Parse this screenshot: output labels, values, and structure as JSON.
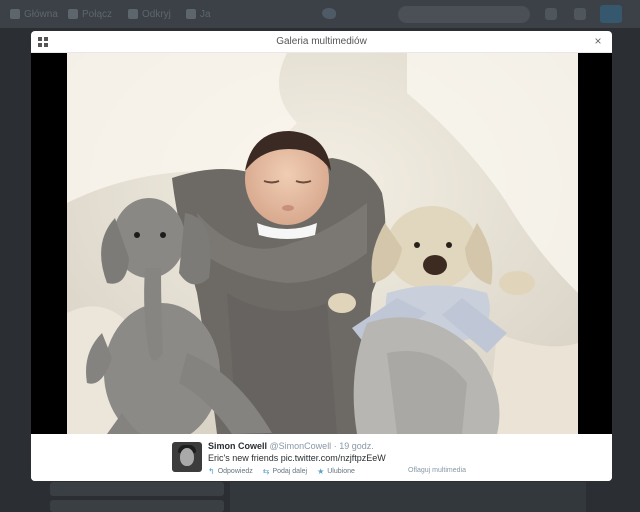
{
  "topbar": {
    "home_label": "Główna",
    "connect_label": "Połącz",
    "discover_label": "Odkryj",
    "me_label": "Ja"
  },
  "modal": {
    "title": "Galeria multimediów",
    "close_glyph": "×"
  },
  "tweet": {
    "name": "Simon Cowell",
    "handle": "@SimonCowell",
    "separator": "·",
    "time": "19 godz.",
    "text": "Eric's new friends pic.twitter.com/nzjftpzEeW",
    "actions": {
      "reply_label": "Odpowiedz",
      "retweet_label": "Podaj dalej",
      "favorite_label": "Ulubione"
    },
    "flag_label": "Oflaguj multimedia"
  },
  "icons": {
    "reply": "reply-icon",
    "retweet": "retweet-icon",
    "favorite": "star-icon",
    "gallery": "grid-icon",
    "close": "close-icon"
  },
  "colors": {
    "backdrop": "#2b2f33",
    "accent": "#5aa0c8",
    "text_primary": "#292f33",
    "text_muted": "#8899a6"
  }
}
